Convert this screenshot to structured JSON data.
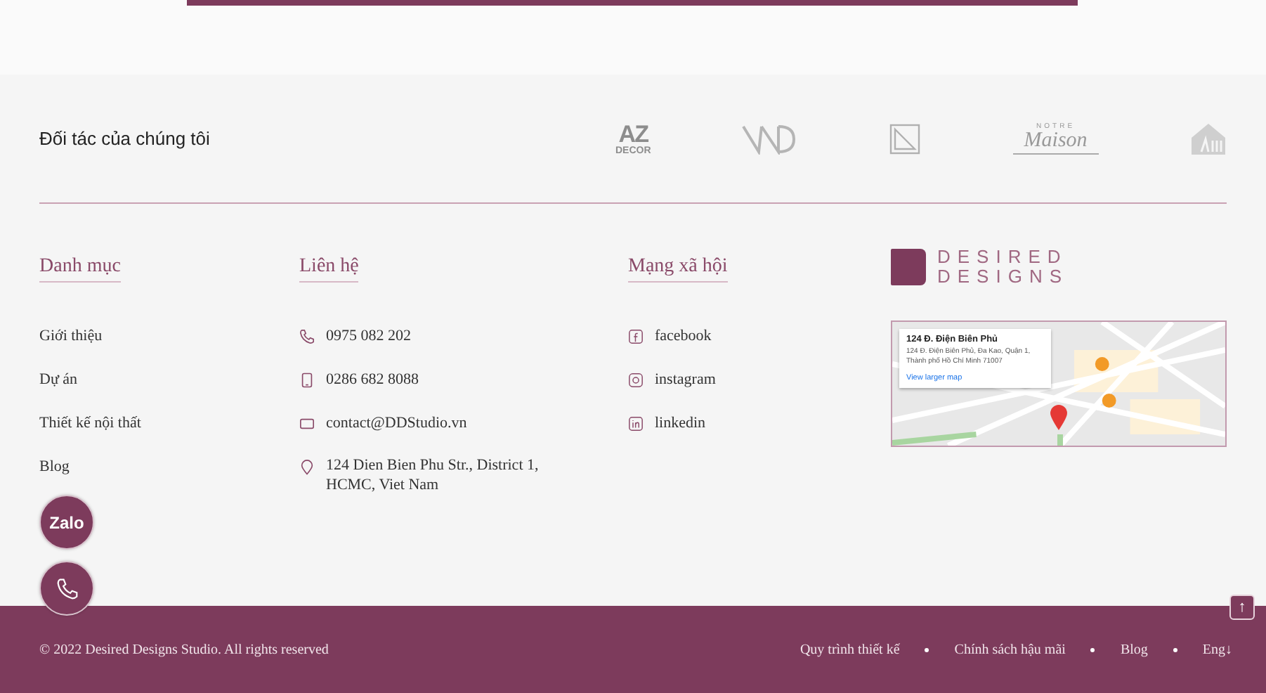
{
  "partners": {
    "title": "Đối tác của chúng tôi",
    "logos": [
      {
        "kind": "stacked",
        "lines": [
          "AZ",
          "DECOR"
        ]
      },
      {
        "kind": "monogram"
      },
      {
        "kind": "frame"
      },
      {
        "kind": "script",
        "lines": [
          "NOTRE",
          "Maison"
        ]
      },
      {
        "kind": "house"
      }
    ]
  },
  "menu": {
    "title": "Danh mục",
    "items": [
      "Giới thiệu",
      "Dự án",
      "Thiết kế nội thất",
      "Blog"
    ]
  },
  "contact": {
    "title": "Liên hệ",
    "items": [
      {
        "kind": "phone",
        "text": "0975 082 202"
      },
      {
        "kind": "mobile",
        "text": "0286 682 8088"
      },
      {
        "kind": "email",
        "text": "contact@DDStudio.vn"
      },
      {
        "kind": "location",
        "text": "124 Dien Bien Phu Str., District 1, HCMC, Viet Nam"
      }
    ]
  },
  "social": {
    "title": "Mạng xã hội",
    "items": [
      {
        "kind": "facebook",
        "text": "facebook"
      },
      {
        "kind": "instagram",
        "text": "instagram"
      },
      {
        "kind": "linkedin",
        "text": "linkedin"
      }
    ]
  },
  "brand": {
    "lines": [
      "DESIRED",
      "DESIGNS"
    ]
  },
  "map": {
    "place": "124 Đ. Điện Biên Phủ",
    "address": "124 Đ. Điện Biên Phủ, Đa Kao, Quận 1, Thành phố Hồ Chí Minh 71007",
    "link": "View larger map"
  },
  "floating": [
    {
      "kind": "zalo",
      "text": "Zalo"
    },
    {
      "kind": "call"
    }
  ],
  "footer": {
    "copyright": "© 2022 Desired Designs Studio. All rights reserved",
    "links": [
      "Quy trình thiết kế",
      "Chính sách hậu mãi",
      "Blog"
    ],
    "language": "Eng↓",
    "top_button": "↑"
  }
}
